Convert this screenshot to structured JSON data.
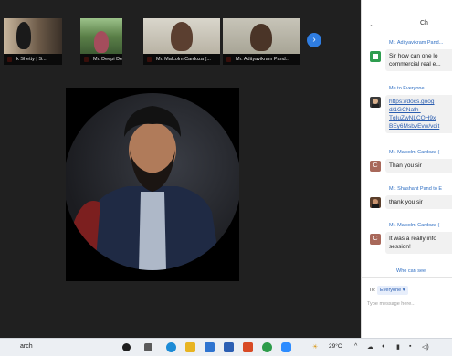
{
  "meeting": {
    "participants": [
      {
        "name": "k Shetty | S..."
      },
      {
        "name": "Mr. Deepi Desh..."
      },
      {
        "name": "Mr. Malcolm Cardoza (..."
      },
      {
        "name": "Mr. Adityavikram Pand..."
      }
    ],
    "next_page_glyph": "›"
  },
  "chat": {
    "title": "Ch",
    "messages": [
      {
        "sender": "Mr. Adityavikram Pand...",
        "avatar": "",
        "avatar_color": "#2e9d4f",
        "lines": [
          "Sir how can one lo",
          "commercial real e..."
        ]
      },
      {
        "sender": "Me to Everyone",
        "avatar": "",
        "avatar_color": "#3a3a3a",
        "link": true,
        "lines": [
          "https://docs.goog",
          "d/1GCNafh-",
          "TgIuZwNLCQH9x",
          "BEy6MsbvEvw/vdit"
        ]
      },
      {
        "sender": "Mr. Malcolm Cardoza (",
        "avatar": "C",
        "avatar_color": "#a8685a",
        "lines": [
          "Than you sir"
        ]
      },
      {
        "sender": "Mr. Shashant Pand to E",
        "avatar": "",
        "avatar_color": "#5a3e2b",
        "lines": [
          "thank you sir"
        ]
      },
      {
        "sender": "Mr. Malcolm Cardoza (",
        "avatar": "C",
        "avatar_color": "#a8685a",
        "lines": [
          "It was a really info",
          "session!"
        ]
      }
    ],
    "who_can_see": "Who can see",
    "to_label": "To:",
    "recipient": "Everyone ▾",
    "input_placeholder": "Type message here..."
  },
  "taskbar": {
    "search_text": "arch",
    "weather": "29°C",
    "icons": [
      {
        "name": "start-icon",
        "color": "#1f1f1f"
      },
      {
        "name": "task-view-icon",
        "color": "#5a5a5a"
      },
      {
        "name": "edge-icon",
        "color": "#1c8bd6"
      },
      {
        "name": "file-explorer-icon",
        "color": "#e8b422"
      },
      {
        "name": "mail-icon",
        "color": "#2f74d0"
      },
      {
        "name": "store-icon",
        "color": "#2c5fb3"
      },
      {
        "name": "office-icon",
        "color": "#d84a25"
      },
      {
        "name": "chrome-icon",
        "color": "#2d9c4a"
      },
      {
        "name": "zoom-icon",
        "color": "#2d8cff"
      }
    ],
    "tray_glyphs": [
      "^",
      "☁",
      "◐",
      "▮",
      "▪",
      "◁)"
    ]
  }
}
